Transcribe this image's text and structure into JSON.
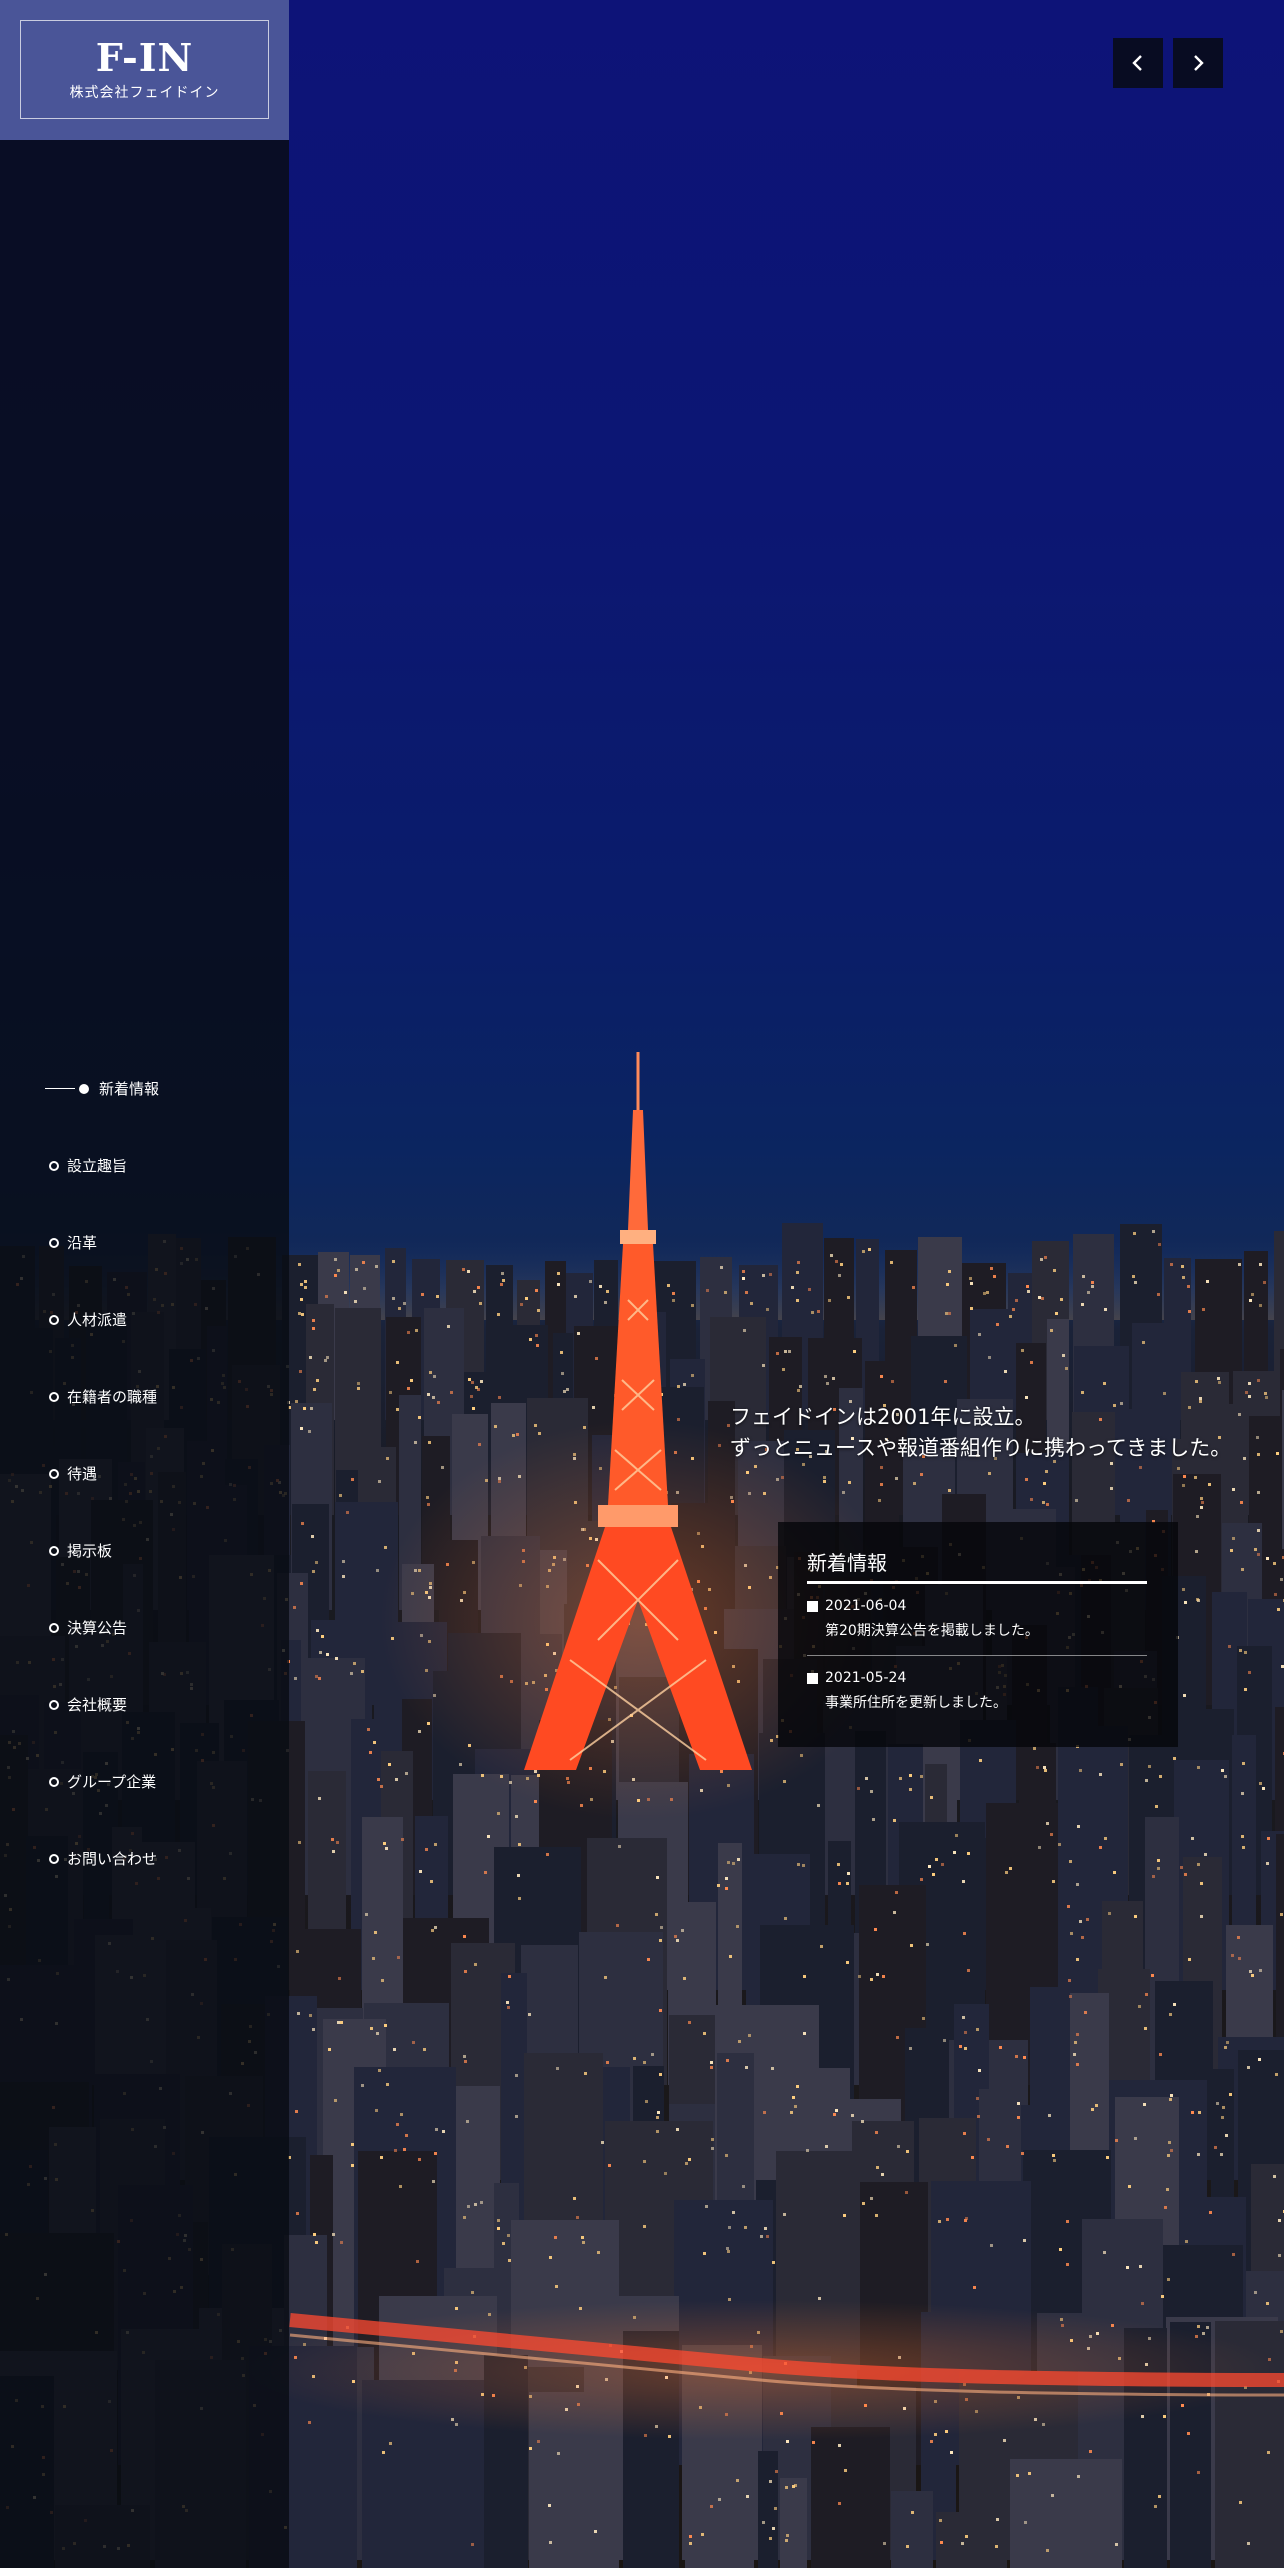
{
  "brand": {
    "logo": "F-IN",
    "company": "株式会社フェイドイン"
  },
  "nav": {
    "items": [
      {
        "label": "新着情報",
        "active": true
      },
      {
        "label": "設立趣旨"
      },
      {
        "label": "沿革"
      },
      {
        "label": "人材派遣"
      },
      {
        "label": "在籍者の職種"
      },
      {
        "label": "待遇"
      },
      {
        "label": "掲示板"
      },
      {
        "label": "決算公告"
      },
      {
        "label": "会社概要"
      },
      {
        "label": "グループ企業"
      },
      {
        "label": "お問い合わせ"
      }
    ]
  },
  "slider": {
    "prev_icon": "chevron-left-icon",
    "next_icon": "chevron-right-icon"
  },
  "hero": {
    "line1": "フェイドインは2001年に設立。",
    "line2": "ずっとニュースや報道番組作りに携わってきました。"
  },
  "news": {
    "title": "新着情報",
    "items": [
      {
        "date": "2021-06-04",
        "text": "第20期決算公告を掲載しました。"
      },
      {
        "date": "2021-05-24",
        "text": "事業所住所を更新しました。"
      }
    ]
  },
  "colors": {
    "logo_bg": "#4a5598",
    "sky_top": "#0d1378",
    "tower": "#ff5a2a",
    "arrow_bg": "#080c22"
  }
}
